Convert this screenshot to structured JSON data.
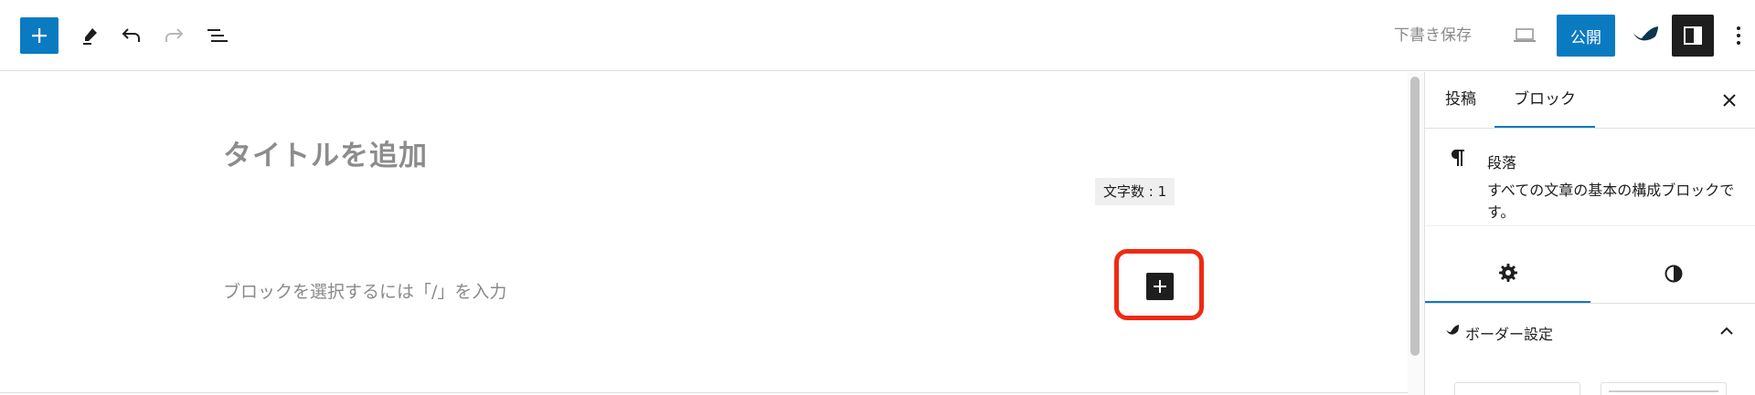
{
  "toolbar": {
    "inserter_icon": "plus-icon",
    "tools_icon": "pencil-icon",
    "undo_icon": "undo-icon",
    "redo_icon": "redo-icon",
    "list_view_icon": "list-view-icon",
    "save_draft_label": "下書き保存",
    "preview_icon": "laptop-icon",
    "publish_label": "公開",
    "plugin_icon": "leaf-icon",
    "settings_icon": "sidebar-icon",
    "options_icon": "more-vertical-icon"
  },
  "editor": {
    "title_placeholder": "タイトルを追加",
    "word_count": "文字数 : 1",
    "block_placeholder": "ブロックを選択するには「/」を入力",
    "inserter_icon": "plus-icon"
  },
  "sidebar": {
    "tabs": [
      {
        "label": "投稿"
      },
      {
        "label": "ブロック"
      }
    ],
    "close_icon": "close-icon",
    "block": {
      "icon": "paragraph-icon",
      "name": "段落",
      "description": "すべての文章の基本の構成ブロックです。"
    },
    "subtabs": [
      {
        "icon": "gear-icon"
      },
      {
        "icon": "half-circle-icon"
      }
    ],
    "panel": {
      "title": "ボーダー設定",
      "icon": "leaf-icon",
      "chevron": "chevron-up-icon"
    }
  },
  "colors": {
    "accent": "#0a7bc1",
    "highlight": "#f02a12",
    "dark": "#1e1e1e"
  }
}
